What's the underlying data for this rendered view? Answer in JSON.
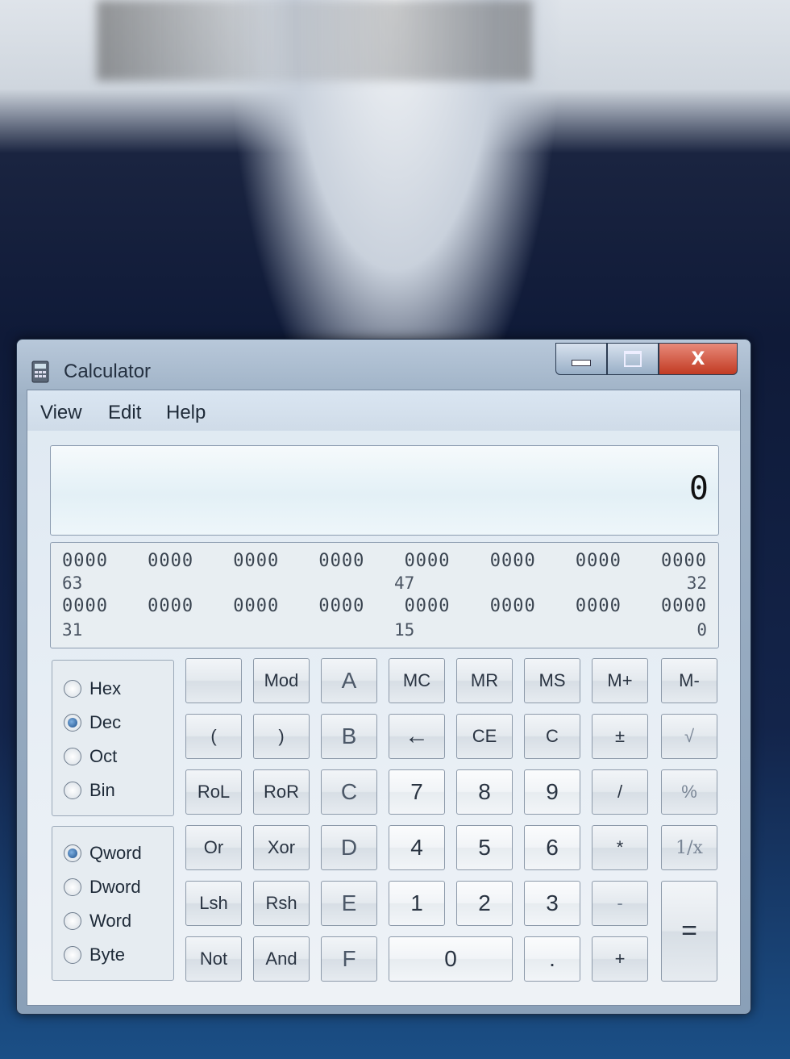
{
  "window": {
    "title": "Calculator",
    "icon": "calculator-icon",
    "controls": {
      "minimize": "minimize-icon",
      "maximize": "maximize-icon",
      "close_label": "X"
    }
  },
  "menu": {
    "view": "View",
    "edit": "Edit",
    "help": "Help"
  },
  "display": {
    "value": "0"
  },
  "binary_panel": {
    "row1": [
      "0000",
      "0000",
      "0000",
      "0000",
      "0000",
      "0000",
      "0000",
      "0000"
    ],
    "row1_idx": {
      "left": "63",
      "mid": "47",
      "right": "32"
    },
    "row2": [
      "0000",
      "0000",
      "0000",
      "0000",
      "0000",
      "0000",
      "0000",
      "0000"
    ],
    "row2_idx": {
      "left": "31",
      "mid": "15",
      "right": "0"
    }
  },
  "radix": {
    "hex": "Hex",
    "dec": "Dec",
    "oct": "Oct",
    "bin": "Bin",
    "selected": "Dec"
  },
  "word_size": {
    "qword": "Qword",
    "dword": "Dword",
    "word": "Word",
    "byte": "Byte",
    "selected": "Qword"
  },
  "keys": {
    "r1": [
      "",
      "Mod",
      "A",
      "MC",
      "MR",
      "MS",
      "M+",
      "M-"
    ],
    "r2": [
      "(",
      ")",
      "B",
      "←",
      "CE",
      "C",
      "±",
      "√"
    ],
    "r3": [
      "RoL",
      "RoR",
      "C",
      "7",
      "8",
      "9",
      "/",
      "%"
    ],
    "r4": [
      "Or",
      "Xor",
      "D",
      "4",
      "5",
      "6",
      "*",
      "1/x"
    ],
    "r5": [
      "Lsh",
      "Rsh",
      "E",
      "1",
      "2",
      "3",
      "-"
    ],
    "r6": [
      "Not",
      "And",
      "F",
      "0",
      ".",
      "+"
    ],
    "equals": "="
  }
}
